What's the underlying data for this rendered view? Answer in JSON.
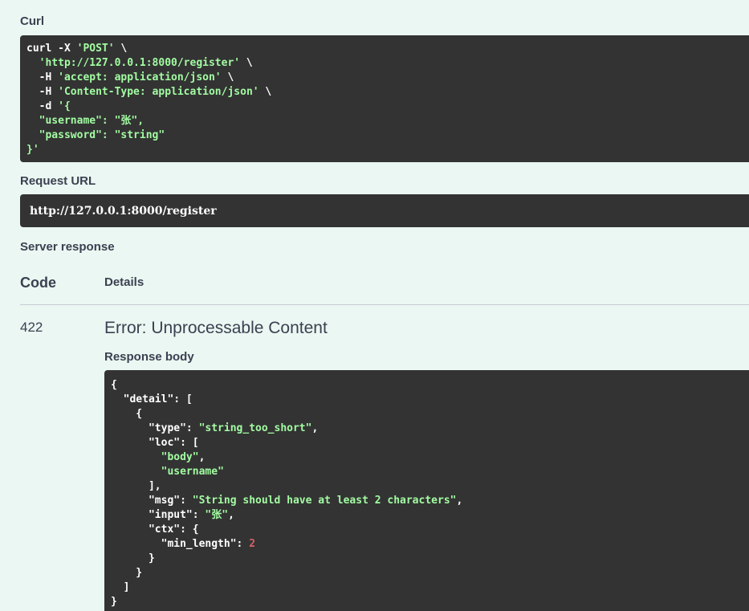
{
  "curl": {
    "label": "Curl",
    "lines": [
      [
        {
          "t": "curl -X ",
          "c": "key"
        },
        {
          "t": "'POST'",
          "c": "str"
        },
        {
          "t": " \\",
          "c": "key"
        }
      ],
      [
        {
          "t": "  ",
          "c": "key"
        },
        {
          "t": "'http://127.0.0.1:8000/register'",
          "c": "str"
        },
        {
          "t": " \\",
          "c": "key"
        }
      ],
      [
        {
          "t": "  -H ",
          "c": "key"
        },
        {
          "t": "'accept: application/json'",
          "c": "str"
        },
        {
          "t": " \\",
          "c": "key"
        }
      ],
      [
        {
          "t": "  -H ",
          "c": "key"
        },
        {
          "t": "'Content-Type: application/json'",
          "c": "str"
        },
        {
          "t": " \\",
          "c": "key"
        }
      ],
      [
        {
          "t": "  -d ",
          "c": "key"
        },
        {
          "t": "'{",
          "c": "str"
        }
      ],
      [
        {
          "t": "  \"username\": \"张\",",
          "c": "str"
        }
      ],
      [
        {
          "t": "  \"password\": \"string\"",
          "c": "str"
        }
      ],
      [
        {
          "t": "}'",
          "c": "str"
        }
      ]
    ]
  },
  "request_url": {
    "label": "Request URL",
    "value": "http://127.0.0.1:8000/register"
  },
  "server_response": {
    "label": "Server response",
    "code_header": "Code",
    "details_header": "Details",
    "code": "422",
    "description": "Error: Unprocessable Content",
    "body_label": "Response body",
    "body_lines": [
      [
        {
          "t": "{",
          "c": "key"
        }
      ],
      [
        {
          "t": "  \"detail\"",
          "c": "key"
        },
        {
          "t": ": [",
          "c": "key"
        }
      ],
      [
        {
          "t": "    {",
          "c": "key"
        }
      ],
      [
        {
          "t": "      \"type\"",
          "c": "key"
        },
        {
          "t": ": ",
          "c": "key"
        },
        {
          "t": "\"string_too_short\"",
          "c": "str"
        },
        {
          "t": ",",
          "c": "key"
        }
      ],
      [
        {
          "t": "      \"loc\"",
          "c": "key"
        },
        {
          "t": ": [",
          "c": "key"
        }
      ],
      [
        {
          "t": "        ",
          "c": "key"
        },
        {
          "t": "\"body\"",
          "c": "str"
        },
        {
          "t": ",",
          "c": "key"
        }
      ],
      [
        {
          "t": "        ",
          "c": "key"
        },
        {
          "t": "\"username\"",
          "c": "str"
        }
      ],
      [
        {
          "t": "      ],",
          "c": "key"
        }
      ],
      [
        {
          "t": "      \"msg\"",
          "c": "key"
        },
        {
          "t": ": ",
          "c": "key"
        },
        {
          "t": "\"String should have at least 2 characters\"",
          "c": "str"
        },
        {
          "t": ",",
          "c": "key"
        }
      ],
      [
        {
          "t": "      \"input\"",
          "c": "key"
        },
        {
          "t": ": ",
          "c": "key"
        },
        {
          "t": "\"张\"",
          "c": "str"
        },
        {
          "t": ",",
          "c": "key"
        }
      ],
      [
        {
          "t": "      \"ctx\"",
          "c": "key"
        },
        {
          "t": ": {",
          "c": "key"
        }
      ],
      [
        {
          "t": "        \"min_length\"",
          "c": "key"
        },
        {
          "t": ": ",
          "c": "key"
        },
        {
          "t": "2",
          "c": "num"
        }
      ],
      [
        {
          "t": "      }",
          "c": "key"
        }
      ],
      [
        {
          "t": "    }",
          "c": "key"
        }
      ],
      [
        {
          "t": "  ]",
          "c": "key"
        }
      ],
      [
        {
          "t": "}",
          "c": "key"
        }
      ]
    ]
  }
}
